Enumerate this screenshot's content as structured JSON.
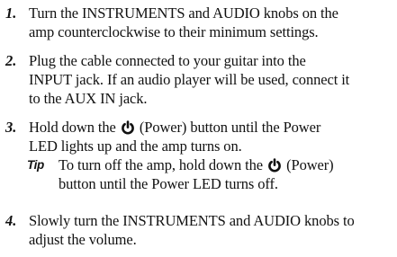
{
  "steps": [
    {
      "number": "1.",
      "lines": [
        "Turn the INSTRUMENTS and AUDIO knobs on the",
        "amp counterclockwise to their minimum settings."
      ]
    },
    {
      "number": "2.",
      "lines": [
        "Plug the cable connected to your guitar into the",
        "INPUT jack. If an audio player will be used, connect it",
        "to the AUX IN jack."
      ]
    },
    {
      "number": "3.",
      "line1_before": "Hold down the",
      "line1_after": "(Power) button until the Power",
      "line2": "LED lights up and the amp turns on.",
      "tip": {
        "label": "Tip",
        "line1_before": "To turn off the amp, hold down the",
        "line1_after": "(Power)",
        "line2": "button until the Power LED turns off."
      }
    },
    {
      "number": "4.",
      "lines": [
        "Slowly turn the INSTRUMENTS and AUDIO knobs to",
        "adjust the volume."
      ]
    }
  ],
  "icons": {
    "power": "power-icon"
  }
}
